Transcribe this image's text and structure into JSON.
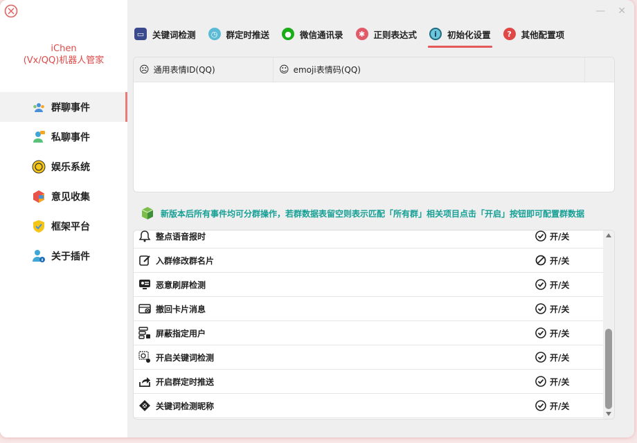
{
  "app": {
    "title_line1": "iChen",
    "title_line2": "(Vx/QQ)机器人管家"
  },
  "sidebar": {
    "items": [
      {
        "label": "群聊事件",
        "icon": "group-chat-icon"
      },
      {
        "label": "私聊事件",
        "icon": "private-chat-icon"
      },
      {
        "label": "娱乐系统",
        "icon": "entertainment-icon"
      },
      {
        "label": "意见收集",
        "icon": "feedback-icon"
      },
      {
        "label": "框架平台",
        "icon": "framework-icon"
      },
      {
        "label": "关于插件",
        "icon": "about-plugin-icon"
      }
    ],
    "active_index": 0
  },
  "tabs": [
    {
      "label": "关键词检测",
      "icon": "keyword-icon",
      "color": "#3b4a8c"
    },
    {
      "label": "群定时推送",
      "icon": "alarm-clock-icon",
      "color": "#5bbad5"
    },
    {
      "label": "微信通讯录",
      "icon": "wechat-icon",
      "color": "#1aad19"
    },
    {
      "label": "正则表达式",
      "icon": "regex-icon",
      "color": "#e05a6a"
    },
    {
      "label": "初始化设置",
      "icon": "info-icon",
      "color": "#6cc6d9"
    },
    {
      "label": "其他配置项",
      "icon": "question-icon",
      "color": "#e04848"
    }
  ],
  "active_tab": 4,
  "grid": {
    "columns": [
      "通用表情ID(QQ)",
      "emoji表情码(QQ)"
    ]
  },
  "notice": "新版本后所有事件均可分群操作，若群数据表留空则表示匹配「所有群」相关项目点击「开启」按钮即可配置群数据",
  "list": {
    "toggle_label": "开/关",
    "rows": [
      {
        "label": "整点语音报时",
        "icon": "bell-icon",
        "state": "on"
      },
      {
        "label": "入群修改群名片",
        "icon": "edit-icon",
        "state": "off"
      },
      {
        "label": "恶意刷屏检测",
        "icon": "screen-monitor-icon",
        "state": "on"
      },
      {
        "label": "撤回卡片消息",
        "icon": "card-recall-icon",
        "state": "on"
      },
      {
        "label": "屏蔽指定用户",
        "icon": "block-user-icon",
        "state": "on"
      },
      {
        "label": "开启关键词检测",
        "icon": "keyword-scan-icon",
        "state": "on"
      },
      {
        "label": "开启群定时推送",
        "icon": "share-icon",
        "state": "on"
      },
      {
        "label": "关键词检测昵称",
        "icon": "nickname-scan-icon",
        "state": "on"
      }
    ]
  },
  "colors": {
    "accent": "#e45a5a",
    "notice": "#16a095",
    "title": "#e04848"
  }
}
